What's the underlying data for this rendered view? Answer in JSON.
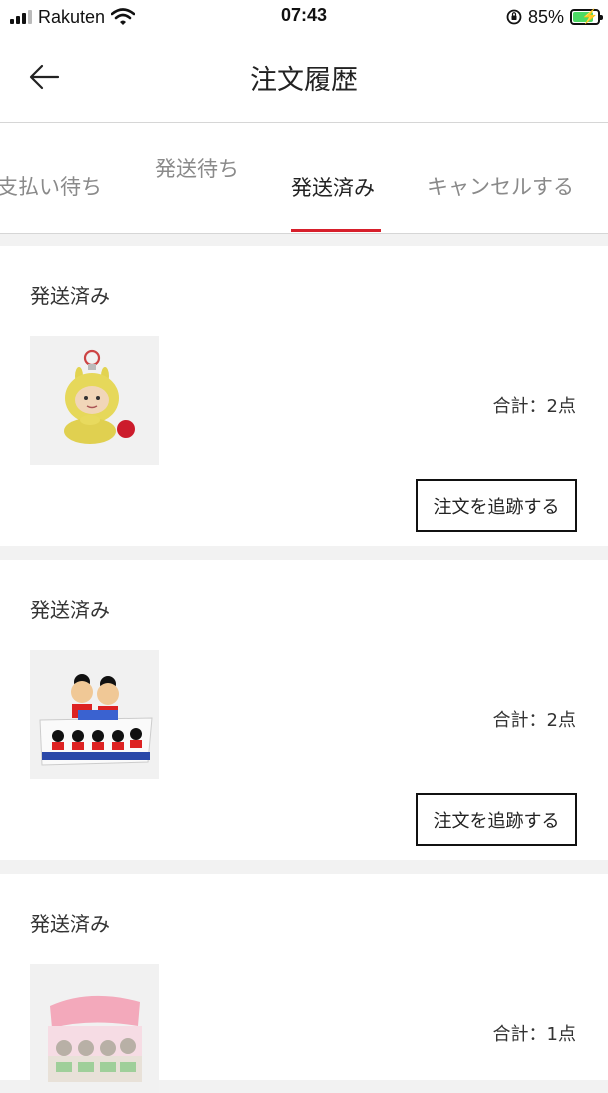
{
  "status_bar": {
    "carrier": "Rakuten",
    "time": "07:43",
    "battery_percent": "85%",
    "battery_level": 0.85
  },
  "header": {
    "title": "注文履歴",
    "back_icon": "arrow-left-icon"
  },
  "tabs": [
    {
      "label": "支払い待ち",
      "active": false
    },
    {
      "label": "発送待ち",
      "active": false
    },
    {
      "label": "発送済み",
      "active": true
    },
    {
      "label": "キャンセルする",
      "active": false
    }
  ],
  "orders": [
    {
      "status": "発送済み",
      "product_image": "yellow-plush-keychain",
      "total": "合計：2点",
      "track_label": "注文を追跡する"
    },
    {
      "status": "発送済み",
      "product_image": "mickey-minnie-blind-box-set",
      "total": "合計：2点",
      "track_label": "注文を追跡する"
    },
    {
      "status": "発送済み",
      "product_image": "pink-character-blind-box-set",
      "total": "合計：1点"
    }
  ],
  "colors": {
    "accent": "#d71f2b",
    "background": "#f2f2f2",
    "battery_green": "#4cd964"
  }
}
